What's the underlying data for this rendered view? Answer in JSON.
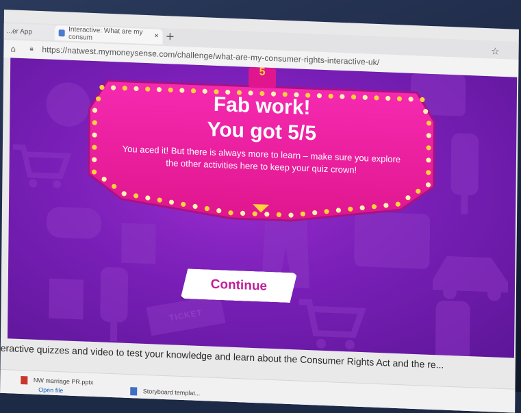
{
  "browser": {
    "tabs": [
      {
        "label": "...er App"
      },
      {
        "label": "Interactive: What are my consum"
      }
    ],
    "new_tab_symbol": "+",
    "close_symbol": "×",
    "url": "https://natwest.mymoneysense.com/challenge/what-are-my-consumer-rights-interactive-uk/"
  },
  "quiz_result": {
    "question_number": "5",
    "title": "Fab work!",
    "score_text": "You got 5/5",
    "message": "You aced it! But there is always more to learn – make sure you explore the other activities here to keep your quiz crown!",
    "continue_label": "Continue",
    "ticket_text": "TICKET"
  },
  "page": {
    "intro_text": "eractive quizzes and video to test your knowledge and learn about the Consumer Rights Act and the re..."
  },
  "downloads": [
    {
      "name": "NW marriage PR.pptx",
      "action": "Open file"
    },
    {
      "name": "Storyboard templat..."
    }
  ],
  "colors": {
    "game_background": "#7a1fb8",
    "sign_pink": "#ee1f9e",
    "bulb_yellow": "#ffd23a",
    "continue_text": "#c0209a"
  },
  "icons": [
    "basketball-icon",
    "shopping-cart-icon",
    "game-controller-icon",
    "grocery-bag-icon",
    "ice-lolly-icon",
    "ticket-icon",
    "car-icon",
    "home-icon",
    "lock-icon",
    "favorites-icon"
  ]
}
